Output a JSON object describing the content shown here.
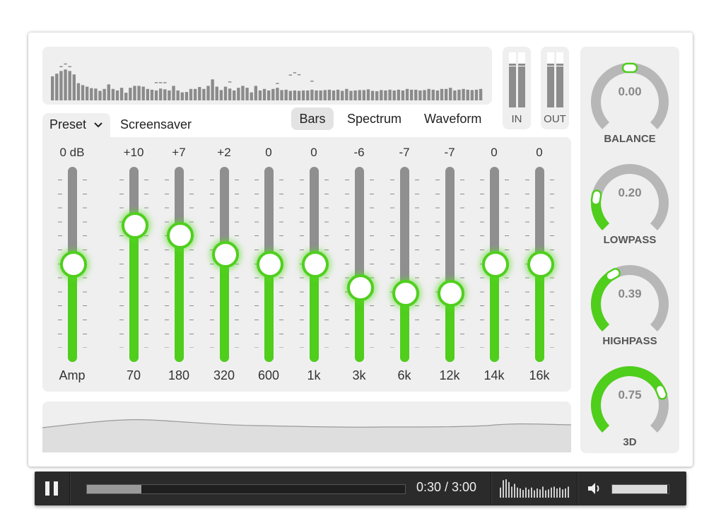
{
  "visualizer": {
    "spectrum_levels": [
      0.63,
      0.7,
      0.77,
      0.81,
      0.77,
      0.68,
      0.45,
      0.4,
      0.36,
      0.32,
      0.31,
      0.25,
      0.3,
      0.42,
      0.3,
      0.26,
      0.33,
      0.2,
      0.33,
      0.38,
      0.38,
      0.36,
      0.3,
      0.28,
      0.26,
      0.31,
      0.29,
      0.26,
      0.38,
      0.26,
      0.21,
      0.22,
      0.3,
      0.3,
      0.35,
      0.3,
      0.38,
      0.55,
      0.36,
      0.27,
      0.36,
      0.31,
      0.26,
      0.33,
      0.38,
      0.33,
      0.21,
      0.38,
      0.26,
      0.3,
      0.26,
      0.3,
      0.33,
      0.27,
      0.28,
      0.25,
      0.26,
      0.25,
      0.26,
      0.26,
      0.28,
      0.26,
      0.26,
      0.27,
      0.28,
      0.26,
      0.28,
      0.25,
      0.3,
      0.25,
      0.26,
      0.27,
      0.27,
      0.29,
      0.25,
      0.24,
      0.27,
      0.26,
      0.28,
      0.26,
      0.28,
      0.26,
      0.3,
      0.28,
      0.28,
      0.26,
      0.27,
      0.3,
      0.28,
      0.26,
      0.3,
      0.3,
      0.33,
      0.26,
      0.28,
      0.3,
      0.28,
      0.27,
      0.28,
      0.3
    ],
    "peak_levels": [
      0,
      0,
      0.86,
      0.93,
      0.86,
      0,
      0,
      0,
      0,
      0,
      0,
      0,
      0,
      0,
      0,
      0,
      0,
      0,
      0,
      0,
      0,
      0,
      0,
      0,
      0.44,
      0.44,
      0.44,
      0,
      0,
      0,
      0,
      0,
      0,
      0,
      0,
      0,
      0,
      0,
      0,
      0,
      0,
      0.46,
      0,
      0,
      0,
      0,
      0,
      0,
      0,
      0,
      0,
      0,
      0.42,
      0,
      0,
      0.64,
      0.7,
      0.65,
      0,
      0,
      0.48,
      0,
      0,
      0,
      0,
      0,
      0,
      0,
      0,
      0,
      0,
      0,
      0,
      0,
      0,
      0,
      0,
      0,
      0,
      0,
      0,
      0,
      0,
      0,
      0,
      0,
      0,
      0,
      0,
      0,
      0,
      0,
      0,
      0,
      0,
      0,
      0,
      0,
      0,
      0
    ]
  },
  "meters": {
    "in_label": "IN",
    "out_label": "OUT"
  },
  "tabs": {
    "preset": "Preset",
    "screensaver": "Screensaver"
  },
  "modes": {
    "bars": "Bars",
    "spectrum": "Spectrum",
    "waveform": "Waveform",
    "selected": "Bars"
  },
  "equalizer": {
    "sliders": [
      {
        "value": "0 dB",
        "freq": "Amp",
        "level": 0.5
      },
      {
        "value": "+10",
        "freq": "70",
        "level": 0.7
      },
      {
        "value": "+7",
        "freq": "180",
        "level": 0.65
      },
      {
        "value": "+2",
        "freq": "320",
        "level": 0.55
      },
      {
        "value": "0",
        "freq": "600",
        "level": 0.5
      },
      {
        "value": "0",
        "freq": "1k",
        "level": 0.5
      },
      {
        "value": "-6",
        "freq": "3k",
        "level": 0.38
      },
      {
        "value": "-7",
        "freq": "6k",
        "level": 0.35
      },
      {
        "value": "-7",
        "freq": "12k",
        "level": 0.35
      },
      {
        "value": "0",
        "freq": "14k",
        "level": 0.5
      },
      {
        "value": "0",
        "freq": "16k",
        "level": 0.5
      }
    ]
  },
  "knobs": [
    {
      "name": "BALANCE",
      "display": "0.00",
      "level": 0.5,
      "mode": "center"
    },
    {
      "name": "LOWPASS",
      "display": "0.20",
      "level": 0.2,
      "mode": "fill"
    },
    {
      "name": "HIGHPASS",
      "display": "0.39",
      "level": 0.39,
      "mode": "fill"
    },
    {
      "name": "3D",
      "display": "0.75",
      "level": 0.75,
      "mode": "fill"
    }
  ],
  "colors": {
    "accent": "#4fce1c",
    "panel": "#efefef",
    "track": "#8f8f8f",
    "player_bg": "#2b2b2b"
  },
  "player": {
    "play_state_icon": "pause-icon",
    "progress": 0.17,
    "time": "0:30 / 3:00",
    "volume": 0.98,
    "mini_bars": [
      0.55,
      0.95,
      1.0,
      0.85,
      0.6,
      0.75,
      0.55,
      0.5,
      0.42,
      0.55,
      0.45,
      0.55,
      0.4,
      0.5,
      0.45,
      0.6,
      0.4,
      0.45,
      0.55,
      0.6,
      0.5,
      0.55,
      0.45,
      0.5,
      0.6
    ]
  }
}
